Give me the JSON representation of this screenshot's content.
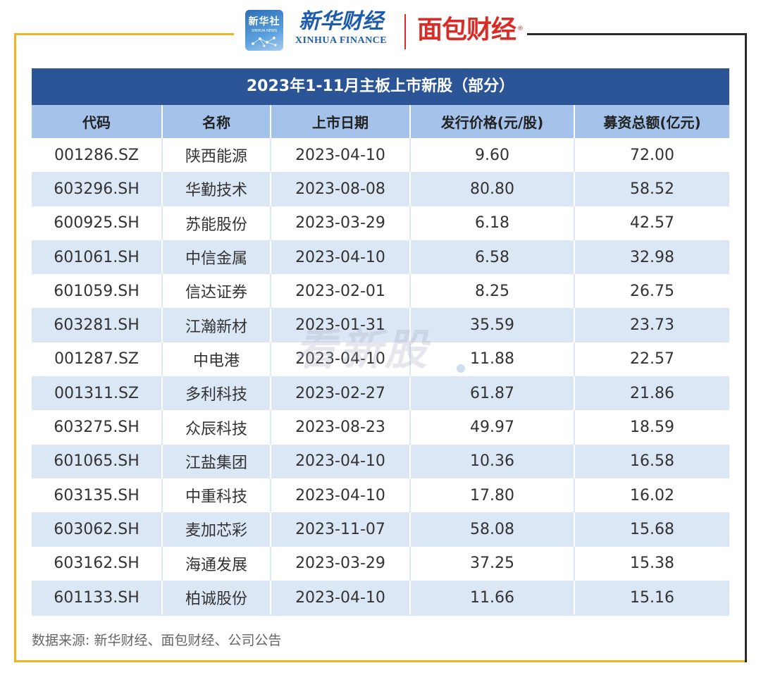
{
  "header": {
    "xinhua_logo_cn": "新华社",
    "xinhua_logo_en": "XINHUA NEWS",
    "brand_cn": "新华财经",
    "brand_en": "XINHUA FINANCE",
    "partner_brand": "面包财经",
    "registered_mark": "®"
  },
  "table": {
    "title": "2023年1-11月主板上市新股（部分）",
    "columns": [
      "代码",
      "名称",
      "上市日期",
      "发行价格(元/股)",
      "募资总额(亿元)"
    ],
    "rows": [
      [
        "001286.SZ",
        "陕西能源",
        "2023-04-10",
        "9.60",
        "72.00"
      ],
      [
        "603296.SH",
        "华勤技术",
        "2023-08-08",
        "80.80",
        "58.52"
      ],
      [
        "600925.SH",
        "苏能股份",
        "2023-03-29",
        "6.18",
        "42.57"
      ],
      [
        "601061.SH",
        "中信金属",
        "2023-04-10",
        "6.58",
        "32.98"
      ],
      [
        "601059.SH",
        "信达证券",
        "2023-02-01",
        "8.25",
        "26.75"
      ],
      [
        "603281.SH",
        "江瀚新材",
        "2023-01-31",
        "35.59",
        "23.73"
      ],
      [
        "001287.SZ",
        "中电港",
        "2023-04-10",
        "11.88",
        "22.57"
      ],
      [
        "001311.SZ",
        "多利科技",
        "2023-02-27",
        "61.87",
        "21.86"
      ],
      [
        "603275.SH",
        "众辰科技",
        "2023-08-23",
        "49.97",
        "18.59"
      ],
      [
        "601065.SH",
        "江盐集团",
        "2023-04-10",
        "10.36",
        "16.58"
      ],
      [
        "603135.SH",
        "中重科技",
        "2023-04-10",
        "17.80",
        "16.02"
      ],
      [
        "603062.SH",
        "麦加芯彩",
        "2023-11-07",
        "58.08",
        "15.68"
      ],
      [
        "603162.SH",
        "海通发展",
        "2023-03-29",
        "37.25",
        "15.38"
      ],
      [
        "601133.SH",
        "柏诚股份",
        "2023-04-10",
        "11.66",
        "15.16"
      ]
    ]
  },
  "watermark": "看新股",
  "source": "数据来源: 新华财经、面包财经、公司公告",
  "colors": {
    "title_bg": "#2c5597",
    "header_bg": "#a5c3ea",
    "stripe_bg": "#dce7f6",
    "frame_gold": "#f0b323",
    "frame_dark": "#2a2a2a",
    "brand_blue": "#1d5bab",
    "brand_red": "#d92c26"
  }
}
